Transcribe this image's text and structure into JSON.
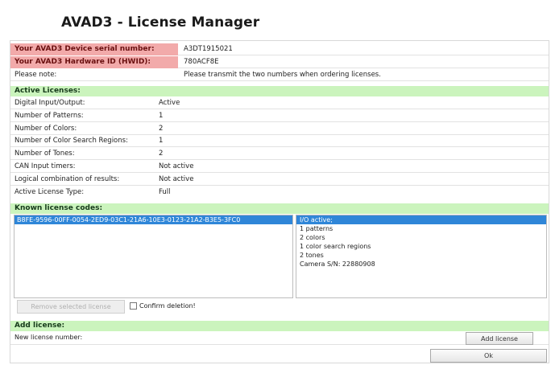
{
  "window": {
    "title": "AVAD3 - License Manager"
  },
  "device": {
    "serial_label": "Your AVAD3 Device serial number:",
    "serial_value": "A3DT1915021",
    "hwid_label": "Your AVAD3 Hardware ID (HWID):",
    "hwid_value": "780ACF8E",
    "note_label": "Please note:",
    "note_value": "Please transmit the two numbers when ordering licenses."
  },
  "active_licenses": {
    "header": "Active Licenses:",
    "rows": [
      {
        "label": "Digital Input/Output:",
        "value": "Active"
      },
      {
        "label": "Number of Patterns:",
        "value": "1"
      },
      {
        "label": "Number of Colors:",
        "value": "2"
      },
      {
        "label": "Number of Color Search Regions:",
        "value": "1"
      },
      {
        "label": "Number of Tones:",
        "value": "2"
      },
      {
        "label": "CAN Input timers:",
        "value": "Not active"
      },
      {
        "label": "Logical combination of results:",
        "value": "Not active"
      },
      {
        "label": "Active License Type:",
        "value": "Full"
      }
    ]
  },
  "known_codes": {
    "header": "Known license codes:",
    "codes": [
      "B8FE-9596-00FF-0054-2ED9-03C1-21A6-10E3-0123-21A2-B3E5-3FC0"
    ],
    "details": [
      "I/O active;",
      "1 patterns",
      "2 colors",
      "1 color search regions",
      "2 tones",
      "Camera S/N: 22880908"
    ],
    "remove_button": "Remove selected license",
    "confirm_label": "Confirm deletion!"
  },
  "add_license": {
    "header": "Add license:",
    "new_label": "New license number:",
    "new_value": "",
    "add_button": "Add license",
    "ok_button": "Ok"
  }
}
